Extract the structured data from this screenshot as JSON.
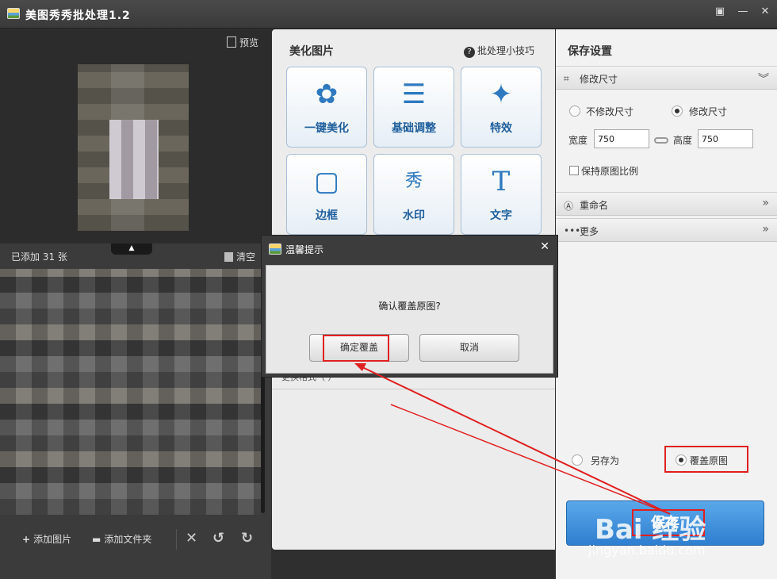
{
  "window": {
    "title": "美图秀秀批处理1.2",
    "buttons": {
      "feedback": "▣",
      "minimize": "—",
      "close": "✕"
    }
  },
  "left_panel": {
    "preview_label": "预览",
    "added_text": "已添加 31 张",
    "clear_label": "清空",
    "toolbar": {
      "add_image": "添加图片",
      "add_folder": "添加文件夹",
      "delete_icon": "✕",
      "rotate_left_icon": "↺",
      "rotate_right_icon": "↻"
    }
  },
  "middle_panel": {
    "title": "美化图片",
    "tips_label": "批处理小技巧",
    "tools": [
      {
        "label": "一键美化",
        "icon": "tulip-icon",
        "glyph": "✿"
      },
      {
        "label": "基础调整",
        "icon": "sliders-icon",
        "glyph": "☰"
      },
      {
        "label": "特效",
        "icon": "magic-wand-icon",
        "glyph": "✦"
      },
      {
        "label": "边框",
        "icon": "frame-icon",
        "glyph": "▢"
      },
      {
        "label": "水印",
        "icon": "watermark-icon",
        "glyph": "秀"
      },
      {
        "label": "文字",
        "icon": "text-icon",
        "glyph": "T"
      }
    ],
    "partial_batch_label": "更换格式（  ）"
  },
  "right_panel": {
    "title": "保存设置",
    "resize_section": "修改尺寸",
    "option_no_resize": "不修改尺寸",
    "option_resize": "修改尺寸",
    "width_label": "宽度",
    "width_value": "750",
    "height_label": "高度",
    "height_value": "750",
    "keep_ratio_label": "保持原图比例",
    "rename_section": "重命名",
    "more_section": "更多",
    "save_as_label": "另存为",
    "overwrite_label": "覆盖原图",
    "save_button": "保存"
  },
  "dialog": {
    "title": "温馨提示",
    "message": "确认覆盖原图?",
    "confirm_button": "确定覆盖",
    "cancel_button": "取消",
    "close_glyph": "✕"
  },
  "watermark": {
    "text": "Bai 经验",
    "url": "jingyan.baidu.com"
  },
  "colors": {
    "accent_blue": "#2e78c0",
    "highlight_red": "#e02020",
    "save_button": "#3d8fdc"
  }
}
